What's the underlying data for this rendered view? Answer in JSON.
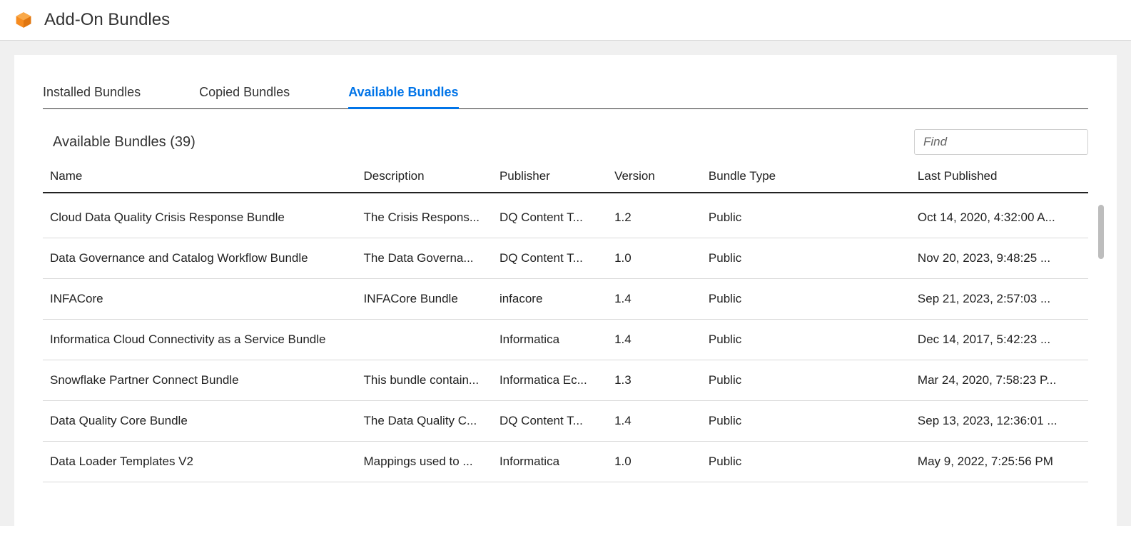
{
  "header": {
    "title": "Add-On Bundles"
  },
  "tabs": [
    {
      "label": "Installed Bundles",
      "active": false
    },
    {
      "label": "Copied Bundles",
      "active": false
    },
    {
      "label": "Available Bundles",
      "active": true
    }
  ],
  "section": {
    "title": "Available Bundles (39)",
    "find_placeholder": "Find"
  },
  "columns": {
    "name": "Name",
    "description": "Description",
    "publisher": "Publisher",
    "version": "Version",
    "bundle_type": "Bundle Type",
    "last_published": "Last Published"
  },
  "rows": [
    {
      "name": "Cloud Data Quality Crisis Response Bundle",
      "description": "The Crisis Respons...",
      "publisher": "DQ Content T...",
      "version": "1.2",
      "bundle_type": "Public",
      "last_published": "Oct 14, 2020, 4:32:00 A..."
    },
    {
      "name": "Data Governance and Catalog Workflow Bundle",
      "description": "The Data Governa...",
      "publisher": "DQ Content T...",
      "version": "1.0",
      "bundle_type": "Public",
      "last_published": "Nov 20, 2023, 9:48:25 ..."
    },
    {
      "name": "INFACore",
      "description": "INFACore Bundle",
      "publisher": "infacore",
      "version": "1.4",
      "bundle_type": "Public",
      "last_published": "Sep 21, 2023, 2:57:03 ..."
    },
    {
      "name": "Informatica Cloud Connectivity as a Service Bundle",
      "description": "",
      "publisher": "Informatica",
      "version": "1.4",
      "bundle_type": "Public",
      "last_published": "Dec 14, 2017, 5:42:23 ..."
    },
    {
      "name": "Snowflake Partner Connect Bundle",
      "description": "This bundle contain...",
      "publisher": "Informatica Ec...",
      "version": "1.3",
      "bundle_type": "Public",
      "last_published": "Mar 24, 2020, 7:58:23 P..."
    },
    {
      "name": "Data Quality Core Bundle",
      "description": "The Data Quality C...",
      "publisher": "DQ Content T...",
      "version": "1.4",
      "bundle_type": "Public",
      "last_published": "Sep 13, 2023, 12:36:01 ..."
    },
    {
      "name": "Data Loader Templates V2",
      "description": "Mappings used to ...",
      "publisher": "Informatica",
      "version": "1.0",
      "bundle_type": "Public",
      "last_published": "May 9, 2022, 7:25:56 PM"
    }
  ]
}
